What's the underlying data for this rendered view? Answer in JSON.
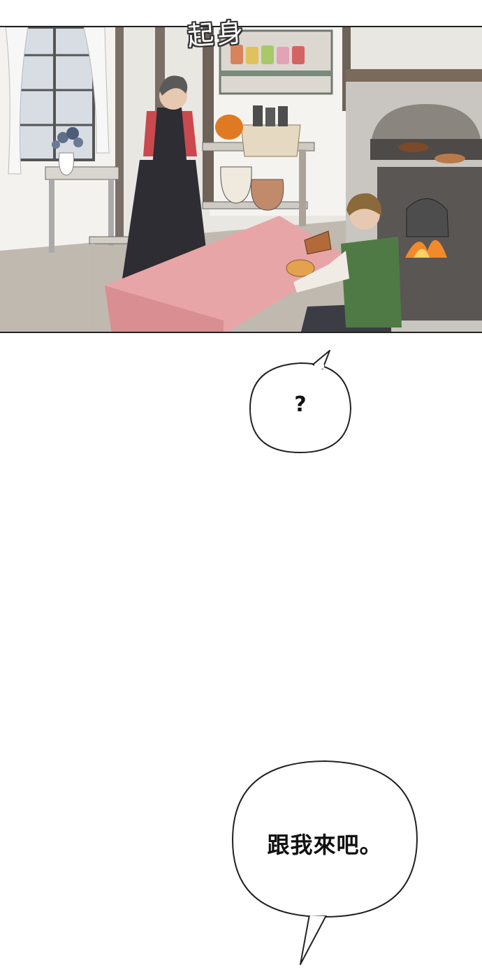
{
  "sfx": {
    "text": "起身"
  },
  "bubbles": {
    "question": {
      "text": "?"
    },
    "follow": {
      "text": "跟我來吧。"
    }
  },
  "colors": {
    "tablecloth": "#e8a5a8",
    "vest": "#4f7a45",
    "shirt_red": "#c9494f",
    "fire": "#f28a2b",
    "pumpkin": "#e07a22"
  }
}
